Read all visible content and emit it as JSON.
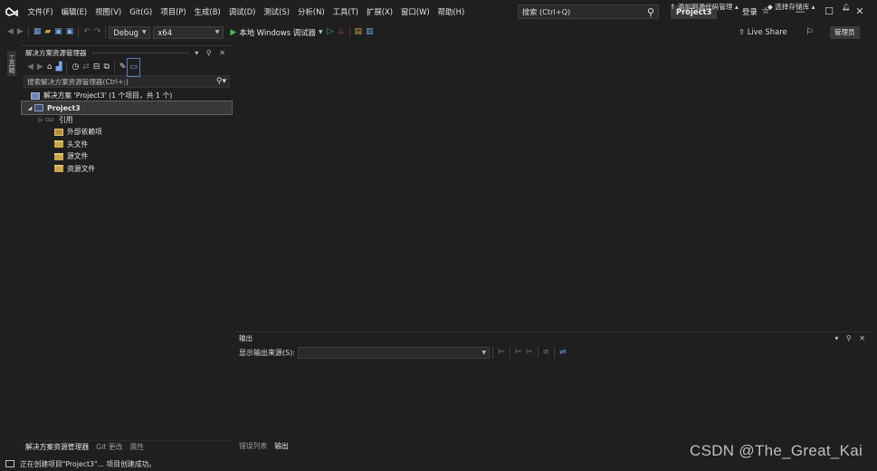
{
  "menu": {
    "items": [
      "文件(F)",
      "编辑(E)",
      "视图(V)",
      "Git(G)",
      "项目(P)",
      "生成(B)",
      "调试(D)",
      "测试(S)",
      "分析(N)",
      "工具(T)",
      "扩展(X)",
      "窗口(W)",
      "帮助(H)"
    ],
    "search_placeholder": "搜索 (Ctrl+Q)",
    "project_name": "Project3",
    "login_label": "登录",
    "window_controls": [
      "—",
      "☐",
      "✕"
    ]
  },
  "toolbar": {
    "config": "Debug",
    "platform": "x64",
    "run_label": "本地 Windows 调试器",
    "live_share": "Live Share",
    "admin_label": "管理员"
  },
  "left_strip": {
    "toolbox_label": "工具箱"
  },
  "solution_explorer": {
    "title": "解决方案资源管理器",
    "search_placeholder": "搜索解决方案资源管理器(Ctrl+;)",
    "tree": {
      "solution": "解决方案 'Project3' (1 个项目，共 1 个)",
      "project": "Project3",
      "items": [
        "引用",
        "外部依赖项",
        "头文件",
        "源文件",
        "资源文件"
      ]
    },
    "tabs": [
      "解决方案资源管理器",
      "Git 更改",
      "属性"
    ]
  },
  "output": {
    "title": "输出",
    "source_label": "显示输出来源(S):",
    "tabs": [
      "错误列表",
      "输出"
    ]
  },
  "status": {
    "message": "正在创建项目\"Project3\"... 项目创建成功。",
    "add_to_source_control": "添加到源代码管理",
    "select_repository": "选择存储库"
  },
  "watermark": "CSDN @The_Great_Kai",
  "colors": {
    "background": "#1f1f1f",
    "run_green": "#3bbf5d",
    "accent_yellow": "#c9a64a"
  }
}
